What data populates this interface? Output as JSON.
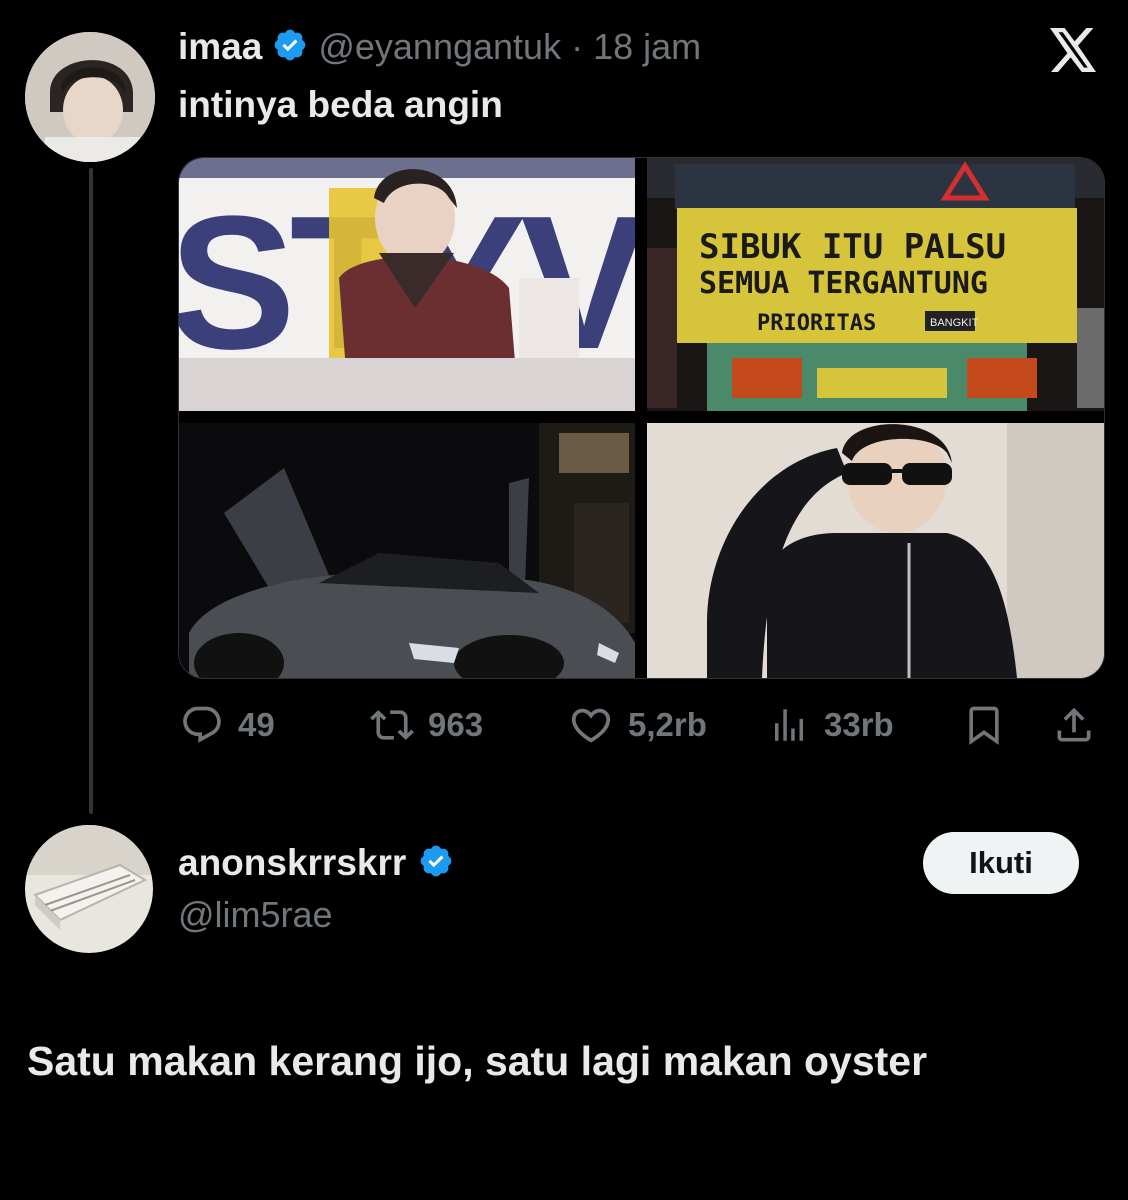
{
  "quoted_tweet": {
    "author_name": "imaa",
    "handle": "@eyanngantuk",
    "separator": "·",
    "time": "18 jam",
    "text": "intinya beda angin",
    "media": [
      {
        "icon": "stage-performer-photo"
      },
      {
        "icon": "truck-back-photo",
        "truck_text": [
          "SIBUK ITU PALSU",
          "SEMUA TERGANTUNG",
          "PRIORITAS"
        ],
        "plate_text": "BANGKIT"
      },
      {
        "icon": "supercar-photo"
      },
      {
        "icon": "person-sunglasses-photo"
      }
    ],
    "stats": {
      "replies": "49",
      "reposts": "963",
      "likes": "5,2rb",
      "views": "33rb"
    }
  },
  "reply": {
    "author_name": "anonskrrskrr",
    "handle": "@lim5rae",
    "follow_label": "Ikuti",
    "text": "Satu makan kerang ijo, satu lagi makan oyster"
  },
  "colors": {
    "background": "#000000",
    "text": "#e7e9ea",
    "muted": "#71767b",
    "verified": "#1d9bf0",
    "follow_bg": "#eff3f4"
  }
}
